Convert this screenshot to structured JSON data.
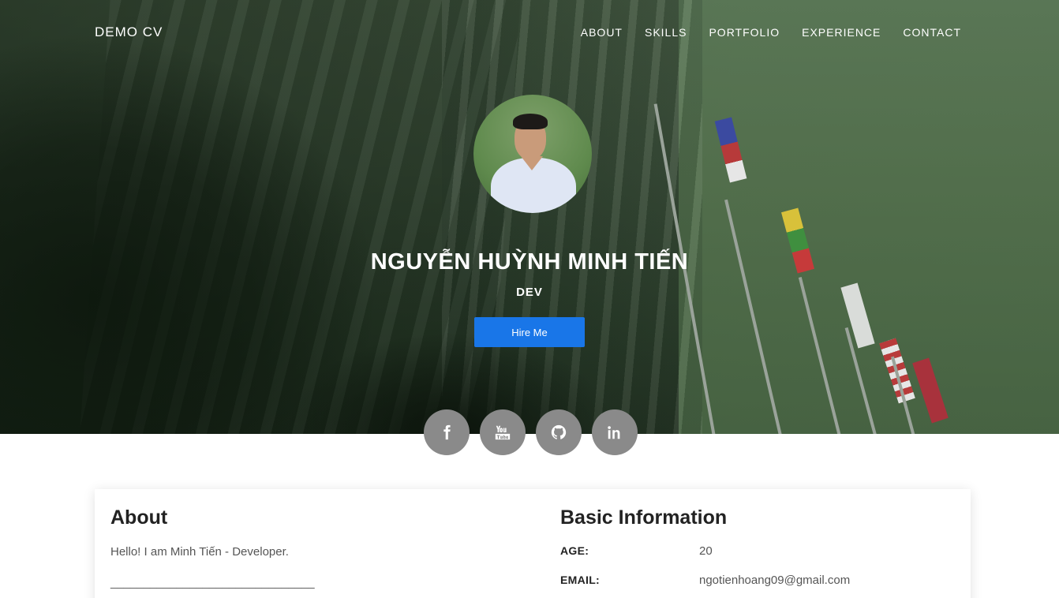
{
  "nav": {
    "brand": "DEMO CV",
    "items": [
      {
        "label": "ABOUT"
      },
      {
        "label": "SKILLS"
      },
      {
        "label": "PORTFOLIO"
      },
      {
        "label": "EXPERIENCE"
      },
      {
        "label": "CONTACT"
      }
    ]
  },
  "hero": {
    "name": "NGUYỄN HUỲNH MINH TIẾN",
    "role": "DEV",
    "cta_label": "Hire Me",
    "socials": [
      {
        "icon": "facebook-icon"
      },
      {
        "icon": "youtube-icon"
      },
      {
        "icon": "github-icon"
      },
      {
        "icon": "linkedin-icon"
      }
    ]
  },
  "about": {
    "heading": "About",
    "text": "Hello! I am Minh Tiến - Developer.",
    "divider": "_______________________________"
  },
  "basic_info": {
    "heading": "Basic Information",
    "rows": [
      {
        "label": "AGE:",
        "value": "20"
      },
      {
        "label": "EMAIL:",
        "value": "ngotienhoang09@gmail.com"
      }
    ]
  },
  "colors": {
    "accent": "#1976e8",
    "social_bg": "#8a8a8a",
    "hero_overlay": "#2a3a29"
  }
}
